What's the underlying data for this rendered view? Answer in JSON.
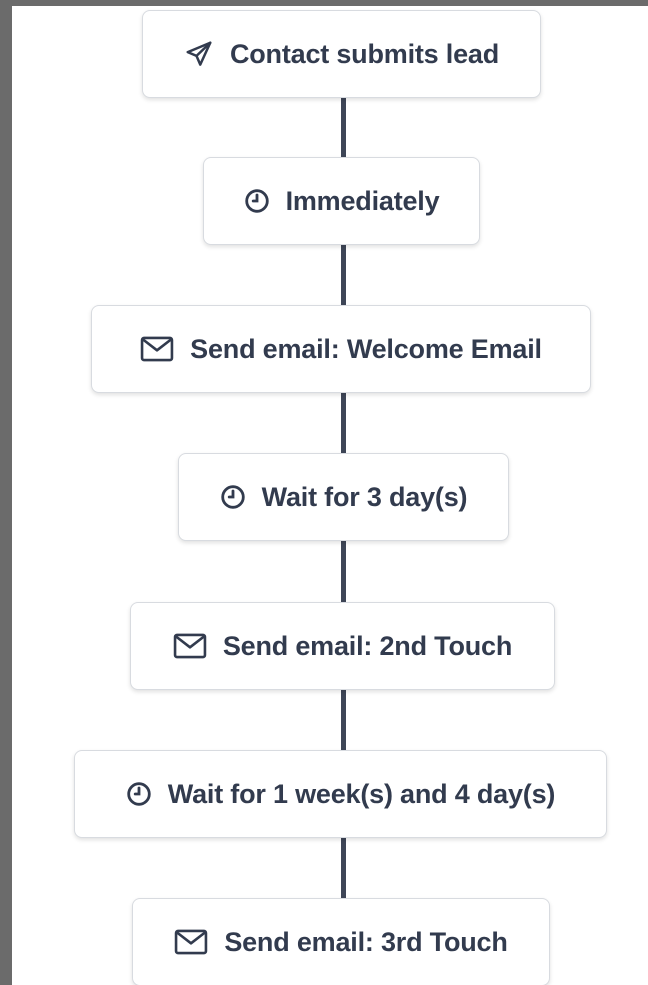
{
  "colors": {
    "line": "#3e4657",
    "text": "#323b4e",
    "node_border": "#d8dbe0",
    "background_outer": "#6b6b6b"
  },
  "workflow": {
    "steps": [
      {
        "type": "trigger",
        "icon": "paper-plane-icon",
        "label": "Contact submits lead"
      },
      {
        "type": "delay",
        "icon": "clock-icon",
        "label": "Immediately"
      },
      {
        "type": "email",
        "icon": "envelope-icon",
        "label": "Send email:  Welcome Email"
      },
      {
        "type": "delay",
        "icon": "clock-icon",
        "label": "Wait for 3 day(s)"
      },
      {
        "type": "email",
        "icon": "envelope-icon",
        "label": "Send email:  2nd Touch"
      },
      {
        "type": "delay",
        "icon": "clock-icon",
        "label": "Wait for 1 week(s) and 4 day(s)"
      },
      {
        "type": "email",
        "icon": "envelope-icon",
        "label": "Send email:  3rd Touch"
      }
    ]
  }
}
